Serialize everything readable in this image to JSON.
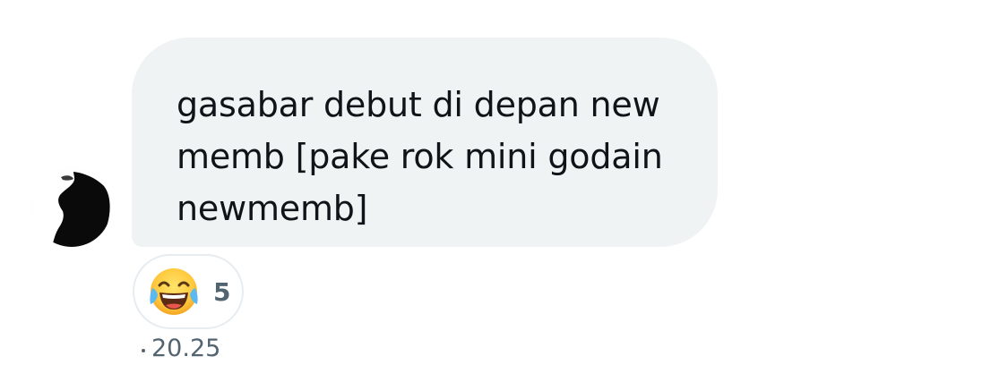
{
  "message": {
    "text": "gasabar debut di depan new memb [pake rok mini godain newmemb]",
    "lines": [
      "gasabar debut di depan new",
      "memb [pake rok mini godain",
      "newmemb]"
    ],
    "bubble_color": "#eff3f4",
    "text_color": "#0f1419"
  },
  "sender": {
    "avatar_icon": "silhouette-avatar-icon"
  },
  "reaction": {
    "emoji_icon": "face-with-tears-of-joy-icon",
    "count": "5"
  },
  "meta": {
    "separator": "·",
    "timestamp": "20.25",
    "muted_color": "#536471"
  }
}
